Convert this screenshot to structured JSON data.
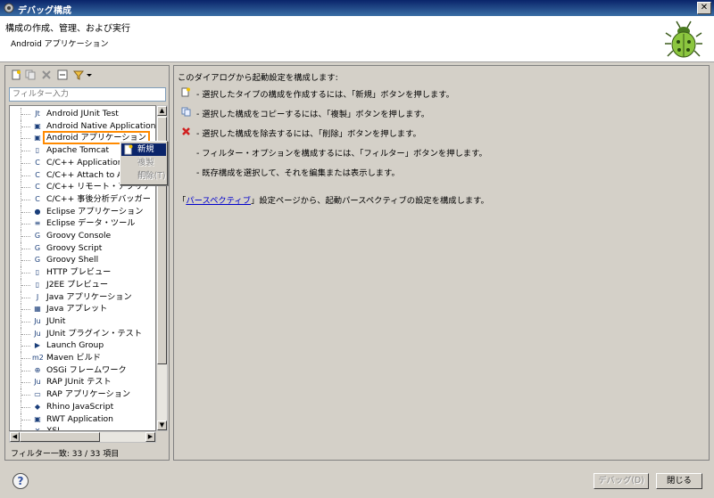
{
  "window": {
    "title": "デバッグ構成",
    "close_glyph": "✕"
  },
  "header": {
    "title": "構成の作成、管理、および実行",
    "subtitle": "Android アプリケーション"
  },
  "left": {
    "filter_placeholder": "フィルター入力",
    "tree": [
      {
        "label": "Android JUnit Test",
        "icon": "junit-icon",
        "glyph": "Jt"
      },
      {
        "label": "Android Native Application",
        "icon": "app-icon",
        "glyph": "▣"
      },
      {
        "label": "Android アプリケーション",
        "icon": "app-icon",
        "glyph": "▣",
        "selected": true
      },
      {
        "label": "Apache Tomcat",
        "icon": "server-icon",
        "glyph": "▯"
      },
      {
        "label": "C/C++ Application",
        "icon": "cpp-icon",
        "glyph": "C"
      },
      {
        "label": "C/C++ Attach to Application",
        "icon": "cpp-icon",
        "glyph": "C"
      },
      {
        "label": "C/C++ リモート・アプリケーション",
        "icon": "cpp-icon",
        "glyph": "C"
      },
      {
        "label": "C/C++ 事後分析デバッガー",
        "icon": "cpp-icon",
        "glyph": "C"
      },
      {
        "label": "Eclipse アプリケーション",
        "icon": "eclipse-icon",
        "glyph": "●"
      },
      {
        "label": "Eclipse データ・ツール",
        "icon": "database-icon",
        "glyph": "≡"
      },
      {
        "label": "Groovy Console",
        "icon": "groovy-icon",
        "glyph": "G"
      },
      {
        "label": "Groovy Script",
        "icon": "groovy-icon",
        "glyph": "G"
      },
      {
        "label": "Groovy Shell",
        "icon": "groovy-icon",
        "glyph": "G"
      },
      {
        "label": "HTTP プレビュー",
        "icon": "server-icon",
        "glyph": "▯"
      },
      {
        "label": "J2EE プレビュー",
        "icon": "server-icon",
        "glyph": "▯"
      },
      {
        "label": "Java アプリケーション",
        "icon": "java-app-icon",
        "glyph": "J"
      },
      {
        "label": "Java アプレット",
        "icon": "applet-icon",
        "glyph": "▦"
      },
      {
        "label": "JUnit",
        "icon": "junit-icon",
        "glyph": "Ju"
      },
      {
        "label": "JUnit プラグイン・テスト",
        "icon": "junit-icon",
        "glyph": "Ju"
      },
      {
        "label": "Launch Group",
        "icon": "launch-group-icon",
        "glyph": "▶"
      },
      {
        "label": "Maven ビルド",
        "icon": "maven-icon",
        "glyph": "m2"
      },
      {
        "label": "OSGi フレームワーク",
        "icon": "osgi-icon",
        "glyph": "⊕"
      },
      {
        "label": "RAP JUnit テスト",
        "icon": "junit-icon",
        "glyph": "Ju"
      },
      {
        "label": "RAP アプリケーション",
        "icon": "rap-icon",
        "glyph": "▭"
      },
      {
        "label": "Rhino JavaScript",
        "icon": "rhino-icon",
        "glyph": "◆"
      },
      {
        "label": "RWT Application",
        "icon": "rwt-icon",
        "glyph": "▣"
      },
      {
        "label": "XSL",
        "icon": "xsl-icon",
        "glyph": "✕"
      }
    ],
    "status": "フィルター一致: 33 / 33 項目"
  },
  "context_menu": {
    "items": [
      {
        "label": "新規(W)",
        "state": "active"
      },
      {
        "label": "複製(D)",
        "state": "disabled"
      },
      {
        "label": "削除(T)",
        "state": "disabled"
      }
    ]
  },
  "right": {
    "intro": "このダイアログから起動設定を構成します:",
    "lines": [
      {
        "text": "- 選択したタイプの構成を作成するには、「新規」ボタンを押します。",
        "icon": "new-config-icon"
      },
      {
        "text": "- 選択した構成をコピーするには、「複製」ボタンを押します。",
        "icon": "duplicate-icon"
      },
      {
        "text": "- 選択した構成を除去するには、「削除」ボタンを押します。",
        "icon": "delete-icon"
      },
      {
        "text": "- フィルター・オプションを構成するには、「フィルター」ボタンを押します。",
        "icon": "filter-icon"
      },
      {
        "text": "- 既存構成を選択して、それを編集または表示します。",
        "icon": "edit-icon"
      }
    ],
    "perspective_prefix": "「",
    "perspective_link": "パースペクティブ",
    "perspective_suffix": "」設定ページから、起動パースペクティブの設定を構成します。"
  },
  "buttons": {
    "help": "?",
    "debug": "デバッグ(D)",
    "close": "閉じる"
  },
  "colors": {
    "title_bar": "#0a246a",
    "selection_outline": "#ff8a00",
    "menu_highlight": "#0a246a",
    "link": "#0000cc"
  }
}
